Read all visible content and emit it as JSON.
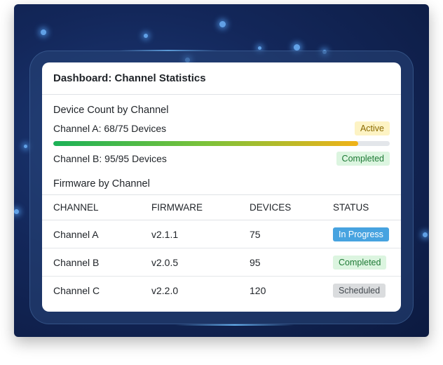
{
  "header": {
    "title": "Dashboard: Channel Statistics"
  },
  "device_count": {
    "title": "Device Count by Channel",
    "channels": [
      {
        "label": "Channel A: 68/75 Devices",
        "status": "Active",
        "progress_fraction": 0.9067
      },
      {
        "label": "Channel B: 95/95 Devices",
        "status": "Completed"
      }
    ]
  },
  "firmware": {
    "title": "Firmware by Channel",
    "columns": [
      "CHANNEL",
      "FIRMWARE",
      "DEVICES",
      "STATUS"
    ],
    "rows": [
      {
        "channel": "Channel A",
        "firmware": "v2.1.1",
        "devices": "75",
        "status": "In Progress"
      },
      {
        "channel": "Channel B",
        "firmware": "v2.0.5",
        "devices": "95",
        "status": "Completed"
      },
      {
        "channel": "Channel C",
        "firmware": "v2.2.0",
        "devices": "120",
        "status": "Scheduled"
      }
    ]
  },
  "colors": {
    "badge_active": "#fdf3c4",
    "badge_completed": "#dcf5e0",
    "badge_in_progress": "#47a3e0",
    "badge_scheduled": "#dadcde",
    "progress_start": "#1bb157",
    "progress_end": "#f0b218"
  }
}
